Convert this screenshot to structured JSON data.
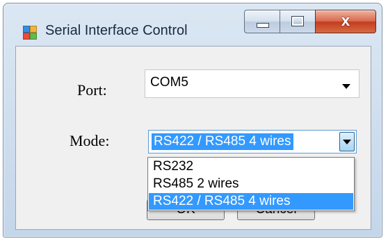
{
  "window": {
    "title": "Serial Interface Control",
    "close_glyph": "x"
  },
  "form": {
    "port_label": "Port:",
    "port_value": "COM5",
    "mode_label": "Mode:",
    "mode_value": "RS422 / RS485 4 wires",
    "ok_label": "OK",
    "cancel_label": "Cancel"
  },
  "mode_options": [
    "RS232",
    "RS485 2 wires",
    "RS422 / RS485 4 wires"
  ],
  "colors": {
    "selection": "#3399ff",
    "close_button": "#c23d1f",
    "title_bar": "#c4d6ea"
  },
  "icons": {
    "app": "app-window-icon",
    "minimize": "minimize-icon",
    "maximize": "maximize-icon",
    "close": "close-icon",
    "dropdown": "chevron-down-icon"
  }
}
